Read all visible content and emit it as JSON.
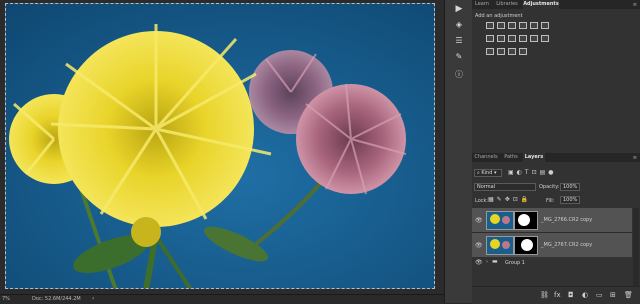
{
  "status": {
    "zoom": "7%",
    "doc": "Doc: 52.6M/244.2M"
  },
  "toolstrip": {
    "tools": [
      "play-icon",
      "adjust-icon",
      "sliders-icon",
      "brush-panel-icon",
      "info-icon"
    ]
  },
  "top_panel": {
    "tabs": [
      "Learn",
      "Libraries",
      "Adjustments"
    ],
    "active_tab": "Adjustments",
    "add_adjustment": "Add an adjustment"
  },
  "layers_panel": {
    "tabs": [
      "Channels",
      "Paths",
      "Layers"
    ],
    "active_tab": "Layers",
    "filter_kind": "Kind",
    "blend_mode": "Normal",
    "opacity_label": "Opacity:",
    "opacity_value": "100%",
    "lock_label": "Lock:",
    "fill_label": "Fill:",
    "fill_value": "100%",
    "layers": [
      {
        "name": "_MG_2766.CR2 copy"
      },
      {
        "name": "_MG_2767.CR2 copy"
      }
    ],
    "group": {
      "name": "Group 1"
    }
  },
  "colors": {
    "background": "#1a5e8e",
    "petal_yellow": "#e6d523",
    "petal_pink": "#b9788e"
  }
}
